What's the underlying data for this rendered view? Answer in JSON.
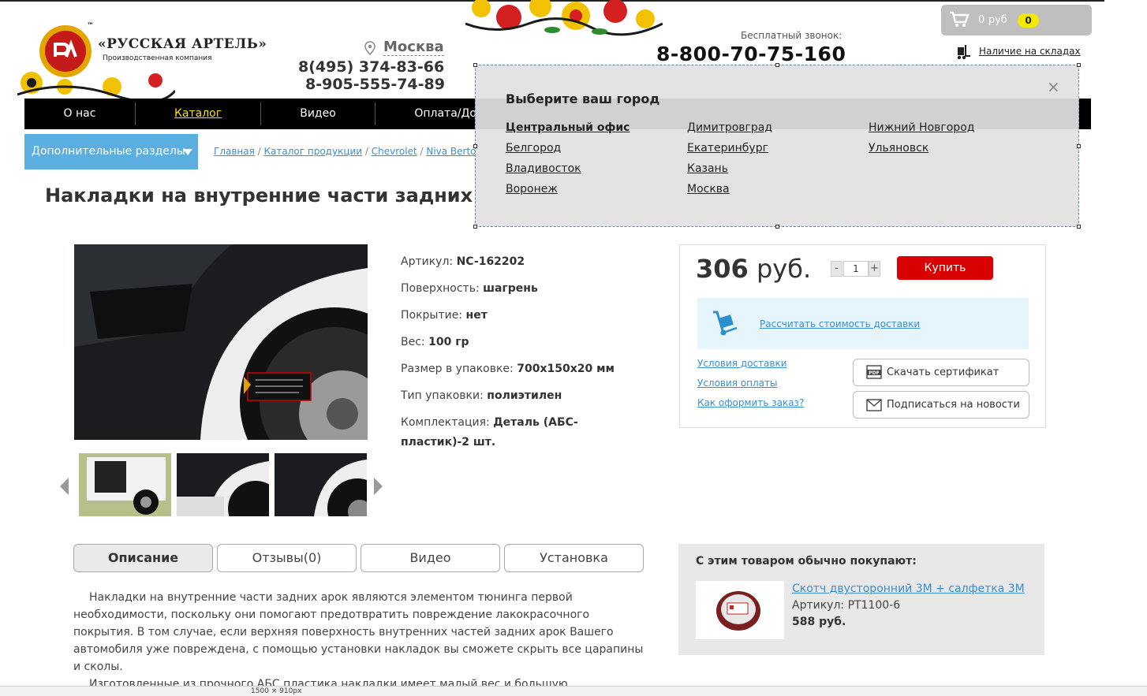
{
  "header": {
    "brand_tm": "™",
    "brand_name": "«РУССКАЯ АРТЕЛЬ»",
    "brand_sub": "Производственная компания",
    "city": "Москва",
    "phone1": "8(495) 374-83-66",
    "phone2": "8-905-555-74-89",
    "free_call_label": "Бесплатный звонок:",
    "free_phone": "8-800-70-75-160",
    "cart_amount": "0",
    "cart_currency": "руб",
    "cart_count": "0",
    "stock_link": "Наличие на складах"
  },
  "nav": {
    "items": [
      {
        "label": "О нас"
      },
      {
        "label": "Каталог"
      },
      {
        "label": "Видео"
      },
      {
        "label": "Оплата/До"
      }
    ]
  },
  "extra_sections": "Дополнительные разделы",
  "breadcrumb": {
    "items": [
      "Главная",
      "Каталог продукции",
      "Chevrolet",
      "Niva Berto"
    ]
  },
  "product": {
    "title": "Накладки на внутренние части задних",
    "specs": [
      {
        "label": "Артикул:",
        "value": "NC-162202"
      },
      {
        "label": "Поверхность:",
        "value": "шагрень"
      },
      {
        "label": "Покрытие:",
        "value": "нет"
      },
      {
        "label": "Вес:",
        "value": "100 гр"
      },
      {
        "label": "Размер в упаковке:",
        "value": "700x150x20 мм"
      },
      {
        "label": "Тип упаковки:",
        "value": "полиэтилен"
      },
      {
        "label": "Комплектация:",
        "value": "Деталь (АБС-пластик)-2 шт."
      }
    ],
    "price_value": "306",
    "price_currency": "руб.",
    "qty": "1",
    "qty_minus": "-",
    "qty_plus": "+",
    "buy_label": "Купить",
    "delivery_calc": "Рассчитать стоимость доставки",
    "links": [
      "Условия доставки",
      "Условия оплаты",
      "Как оформить заказ?"
    ],
    "cert_button": "Скачать сертификат",
    "subscribe_button": "Подписаться на новости"
  },
  "tabs": [
    {
      "label": "Описание"
    },
    {
      "label": "Отзывы(0)"
    },
    {
      "label": "Видео"
    },
    {
      "label": "Установка"
    }
  ],
  "description": {
    "p1": "Накладки на внутренние части задних арок являются элементом тюнинга первой необходимости, поскольку они помогают предотвратить повреждение лакокрасочного покрытия. В том случае, если верхняя поверхность внутренних частей задних арок Вашего автомобиля уже повреждена, с помощью установки накладок вы сможете скрыть все царапины и сколы.",
    "p2": "Изготовленные из прочного АБС пластика накладки имеет малый вес и большую долговечность."
  },
  "related": {
    "title": "С этим товаром обычно покупают:",
    "name": "Скотч двусторонний 3М + салфетка 3М",
    "sku": "Артикул: PT1100-6",
    "price": "588 руб."
  },
  "city_modal": {
    "title": "Выберите ваш город",
    "close": "×",
    "columns": [
      [
        "Центральный офис",
        "Белгород",
        "Владивосток",
        "Воронеж"
      ],
      [
        "Димитровград",
        "Екатеринбург",
        "Казань",
        "Москва"
      ],
      [
        "Нижний Новгород",
        "Ульяновск"
      ]
    ]
  },
  "statusbar": {
    "size_text": "1500 × 910px"
  },
  "colors": {
    "nav_bg": "#000000",
    "nav_active": "#f5e000",
    "accent_blue": "#5aaee0",
    "link_blue": "#3a8fd0",
    "buy_red": "#d80000",
    "cart_badge": "#f5e800"
  }
}
